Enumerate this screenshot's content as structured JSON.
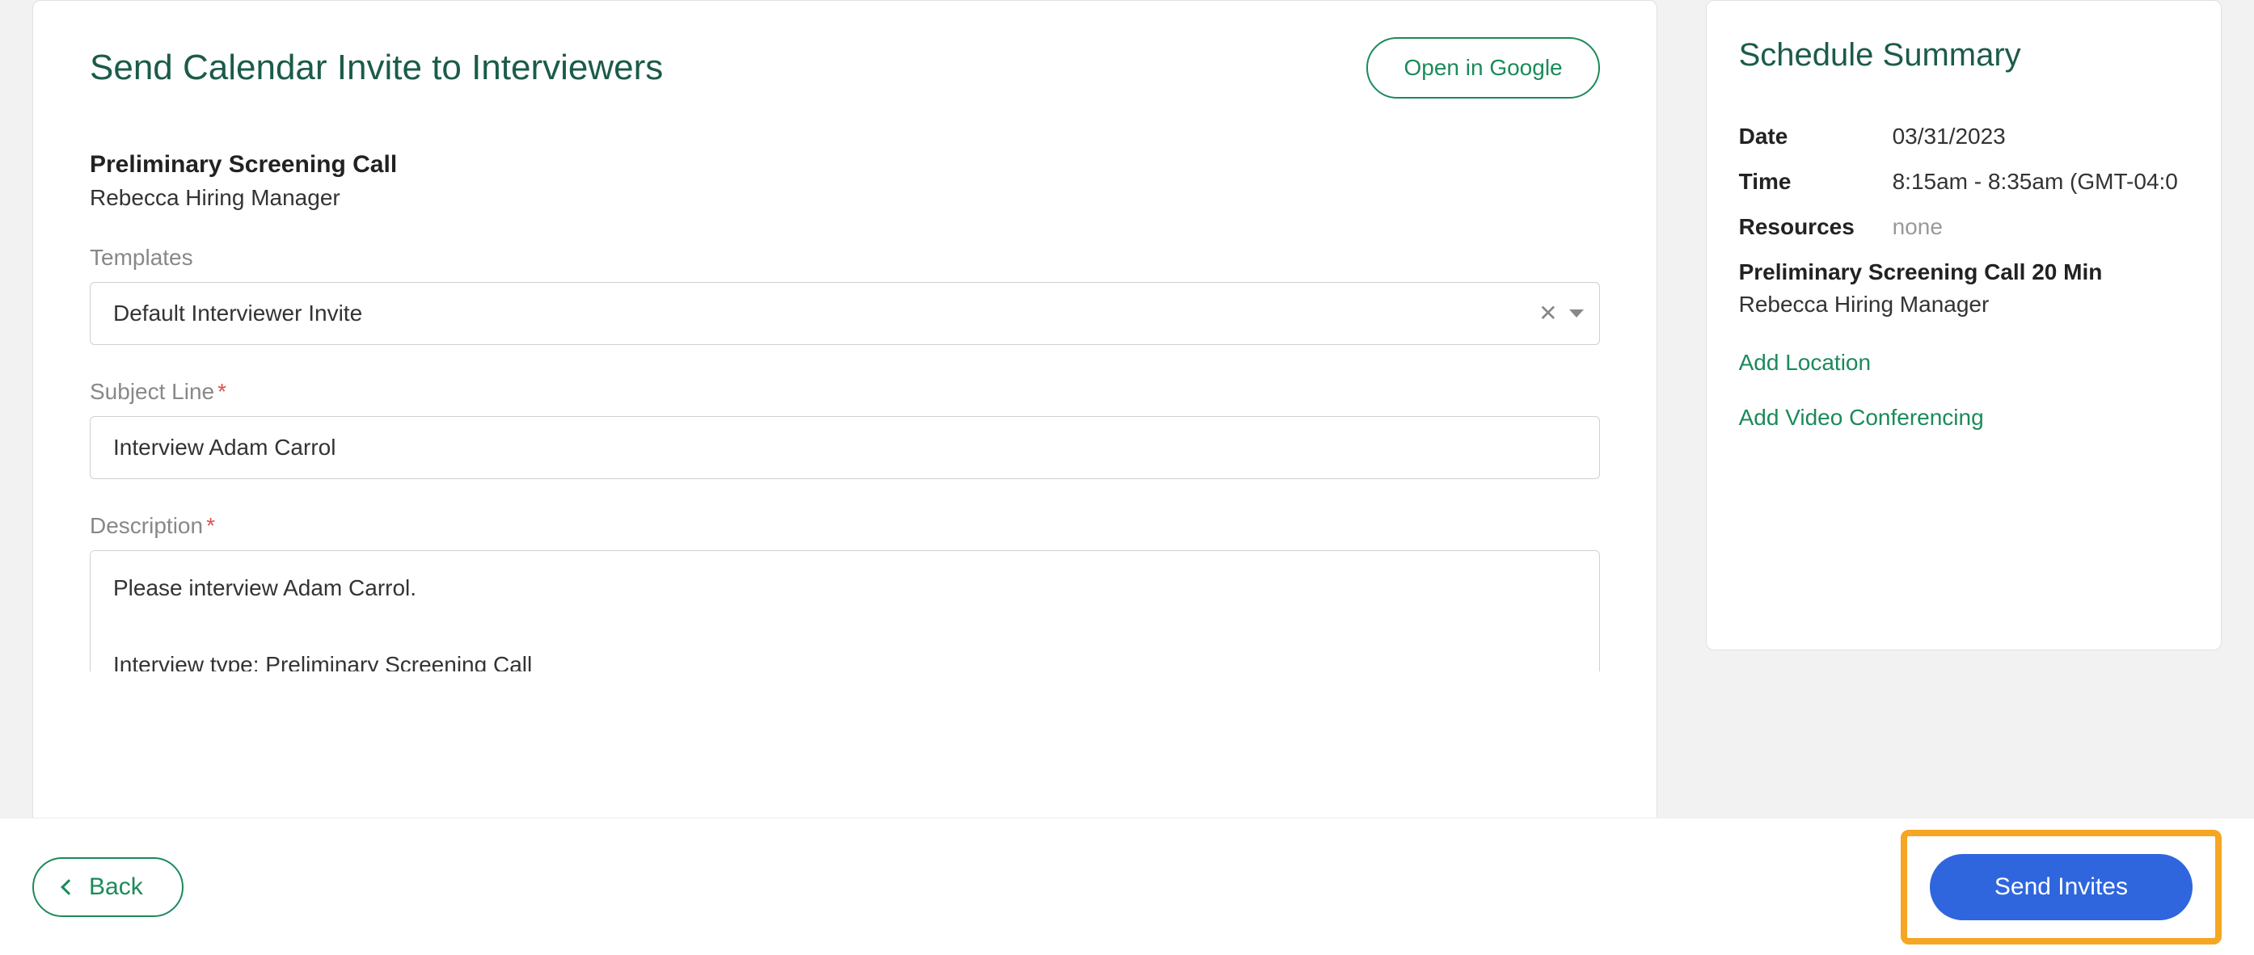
{
  "main": {
    "title": "Send Calendar Invite to Interviewers",
    "open_in_google_label": "Open in Google",
    "call_name": "Preliminary Screening Call",
    "interviewer_name": "Rebecca Hiring Manager",
    "templates_label": "Templates",
    "templates_value": "Default Interviewer Invite",
    "subject_label": "Subject Line",
    "subject_value": "Interview Adam Carrol",
    "description_label": "Description",
    "description_value": "Please interview Adam Carrol.\n\nInterview type: Preliminary Screening Call"
  },
  "summary": {
    "title": "Schedule Summary",
    "date_label": "Date",
    "date_value": "03/31/2023",
    "time_label": "Time",
    "time_value": "8:15am - 8:35am (GMT-04:0",
    "resources_label": "Resources",
    "resources_value": "none",
    "call_title": "Preliminary Screening Call 20 Min",
    "person": "Rebecca Hiring Manager",
    "add_location_label": "Add Location",
    "add_video_label": "Add Video Conferencing"
  },
  "footer": {
    "back_label": "Back",
    "send_label": "Send Invites"
  }
}
